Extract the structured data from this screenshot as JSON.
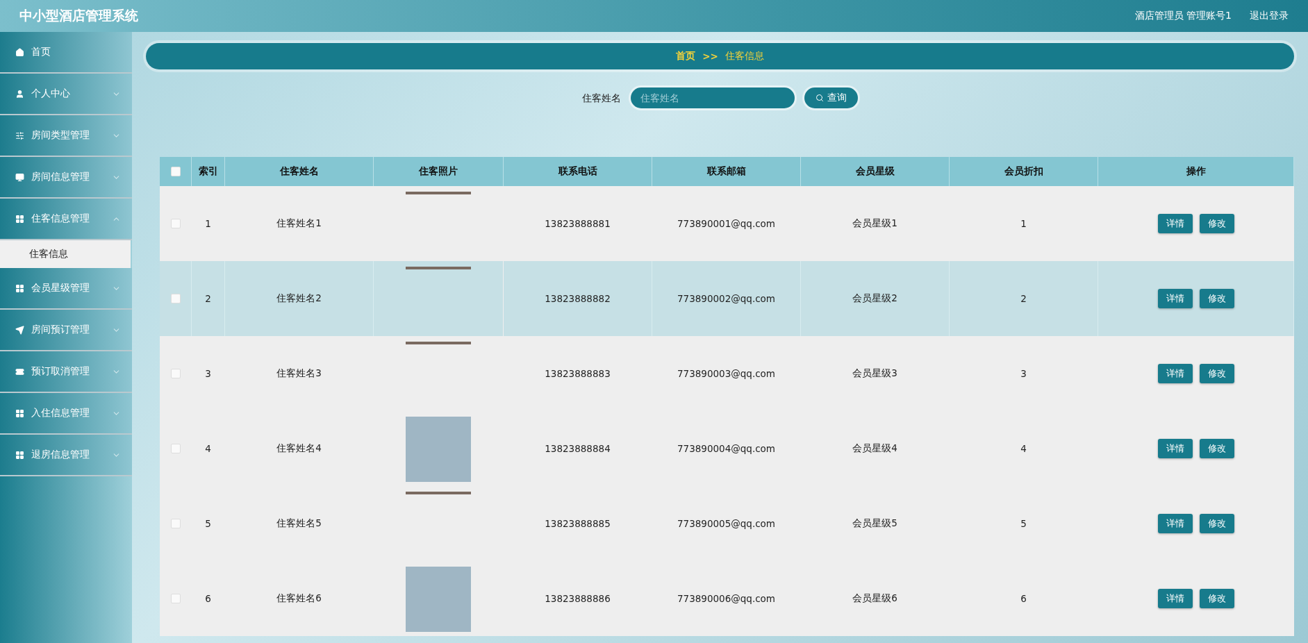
{
  "header": {
    "title": "中小型酒店管理系统",
    "user": "酒店管理员 管理账号1",
    "logout": "退出登录"
  },
  "sidebar": {
    "items": [
      {
        "label": "首页",
        "kind": "link"
      },
      {
        "label": "个人中心",
        "kind": "menu",
        "expanded": false
      },
      {
        "label": "房间类型管理",
        "kind": "menu",
        "expanded": false
      },
      {
        "label": "房间信息管理",
        "kind": "menu",
        "expanded": false
      },
      {
        "label": "住客信息管理",
        "kind": "menu",
        "expanded": true,
        "children": [
          {
            "label": "住客信息",
            "selected": true
          }
        ]
      },
      {
        "label": "会员星级管理",
        "kind": "menu",
        "expanded": false
      },
      {
        "label": "房间预订管理",
        "kind": "menu",
        "expanded": false
      },
      {
        "label": "预订取消管理",
        "kind": "menu",
        "expanded": false
      },
      {
        "label": "入住信息管理",
        "kind": "menu",
        "expanded": false
      },
      {
        "label": "退房信息管理",
        "kind": "menu",
        "expanded": false
      }
    ]
  },
  "breadcrumb": {
    "home": "首页",
    "separator": ">>",
    "current": "住客信息"
  },
  "search": {
    "label": "住客姓名",
    "placeholder": "住客姓名",
    "button": "查询"
  },
  "table": {
    "columns": [
      "索引",
      "住客姓名",
      "住客照片",
      "联系电话",
      "联系邮箱",
      "会员星级",
      "会员折扣",
      "操作"
    ],
    "header_checked": false,
    "rows": [
      {
        "index": "1",
        "name": "住客姓名1",
        "photo_loaded": false,
        "phone": "13823888881",
        "email": "773890001@qq.com",
        "level": "会员星级1",
        "discount": "1",
        "checked": false,
        "highlighted": false,
        "actions": [
          "详情",
          "修改"
        ]
      },
      {
        "index": "2",
        "name": "住客姓名2",
        "photo_loaded": false,
        "phone": "13823888882",
        "email": "773890002@qq.com",
        "level": "会员星级2",
        "discount": "2",
        "checked": false,
        "highlighted": true,
        "actions": [
          "详情",
          "修改"
        ]
      },
      {
        "index": "3",
        "name": "住客姓名3",
        "photo_loaded": false,
        "phone": "13823888883",
        "email": "773890003@qq.com",
        "level": "会员星级3",
        "discount": "3",
        "checked": false,
        "highlighted": false,
        "actions": [
          "详情",
          "修改"
        ]
      },
      {
        "index": "4",
        "name": "住客姓名4",
        "photo_loaded": true,
        "phone": "13823888884",
        "email": "773890004@qq.com",
        "level": "会员星级4",
        "discount": "4",
        "checked": false,
        "highlighted": false,
        "actions": [
          "详情",
          "修改"
        ]
      },
      {
        "index": "5",
        "name": "住客姓名5",
        "photo_loaded": false,
        "phone": "13823888885",
        "email": "773890005@qq.com",
        "level": "会员星级5",
        "discount": "5",
        "checked": false,
        "highlighted": false,
        "actions": [
          "详情",
          "修改"
        ]
      },
      {
        "index": "6",
        "name": "住客姓名6",
        "photo_loaded": true,
        "phone": "13823888886",
        "email": "773890006@qq.com",
        "level": "会员星级6",
        "discount": "6",
        "checked": false,
        "highlighted": false,
        "actions": [
          "详情",
          "修改"
        ]
      }
    ]
  }
}
